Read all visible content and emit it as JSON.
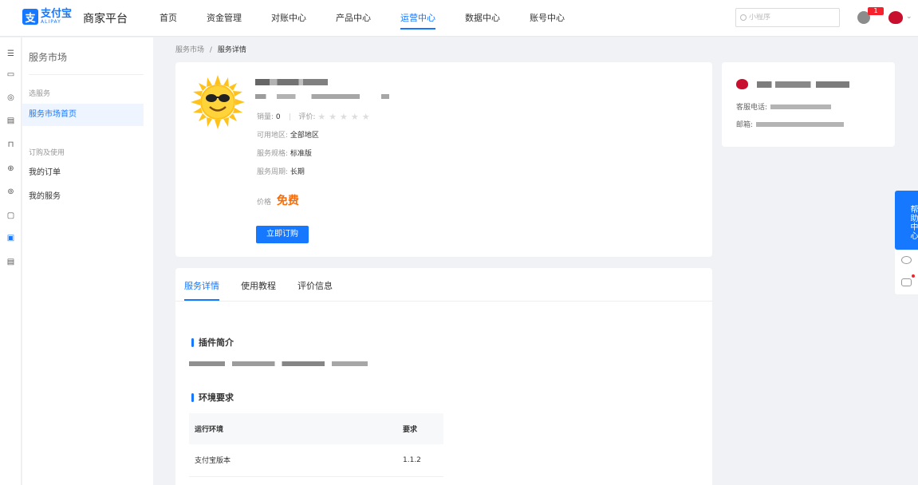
{
  "header": {
    "logo_cn": "支付宝",
    "logo_en": "ALIPAY",
    "platform_title": "商家平台",
    "nav": [
      "首页",
      "资金管理",
      "对账中心",
      "产品中心",
      "运营中心",
      "数据中心",
      "账号中心"
    ],
    "active_nav": "运营中心",
    "search_placeholder": "小程序",
    "notification_count": "1"
  },
  "sidebar": {
    "title": "服务市场",
    "groups": [
      {
        "label": "选服务",
        "items": [
          "服务市场首页"
        ]
      },
      {
        "label": "订购及使用",
        "items": [
          "我的订单",
          "我的服务"
        ]
      }
    ],
    "active_item": "服务市场首页"
  },
  "breadcrumb": {
    "parent": "服务市场",
    "sep": "/",
    "current": "服务详情"
  },
  "product": {
    "sales_label": "销量:",
    "sales_value": "0",
    "rating_label": "评价:",
    "rating_stars": 0,
    "region_label": "可用地区:",
    "region_value": "全部地区",
    "spec_label": "服务规格:",
    "spec_value": "标准版",
    "period_label": "服务周期:",
    "period_value": "长期",
    "price_label": "价格",
    "price_value": "免费",
    "buy_button": "立即订购"
  },
  "vendor": {
    "phone_label": "客服电话:",
    "email_label": "邮箱:"
  },
  "detail": {
    "tabs": [
      "服务详情",
      "使用教程",
      "评价信息"
    ],
    "active_tab": "服务详情",
    "intro_heading": "插件简介",
    "env_heading": "环境要求",
    "table": {
      "headers": [
        "运行环境",
        "要求"
      ],
      "rows": [
        [
          "支付宝版本",
          "1.1.2"
        ]
      ]
    }
  },
  "help": {
    "label": "帮助中心"
  },
  "colors": {
    "accent": "#1677ff",
    "price": "#ff6a00",
    "badge": "#f5222d"
  }
}
